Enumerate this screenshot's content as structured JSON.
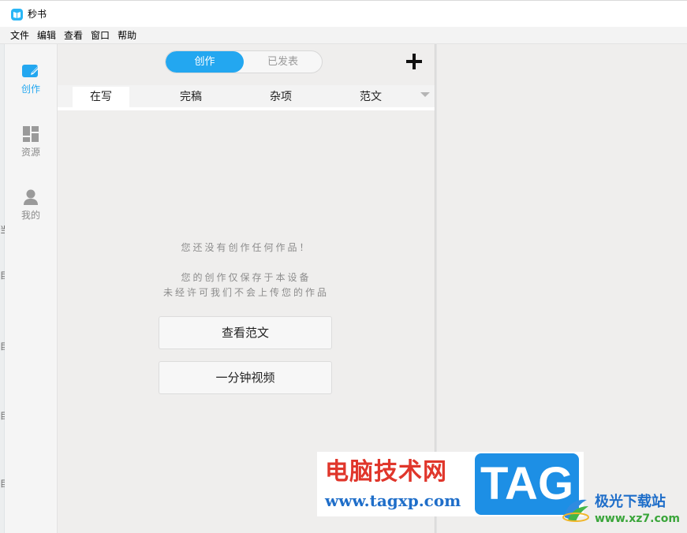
{
  "window": {
    "title": "秒书"
  },
  "menubar": {
    "items": [
      "文件",
      "编辑",
      "查看",
      "窗口",
      "帮助"
    ]
  },
  "leftnav": {
    "accent_color": "#23a7f0",
    "items": [
      {
        "label": "创作",
        "icon": "pencil-note-icon",
        "active": true
      },
      {
        "label": "资源",
        "icon": "grid-blocks-icon",
        "active": false
      },
      {
        "label": "我的",
        "icon": "user-icon",
        "active": false
      }
    ]
  },
  "main": {
    "segment": {
      "options": [
        "创作",
        "已发表"
      ],
      "selected": "创作"
    },
    "add_icon": "plus-icon",
    "tabs": {
      "items": [
        "在写",
        "完稿",
        "杂项",
        "范文"
      ],
      "selected": "在写"
    },
    "empty": {
      "line1": "您还没有创作任何作品！",
      "line2": "您的创作仅保存于本设备",
      "line3": "未经许可我们不会上传您的作品"
    },
    "buttons": {
      "view_samples": "查看范文",
      "one_minute_video": "一分钟视频"
    }
  },
  "watermark": {
    "cn_title": "电脑技术网",
    "url": "www.tagxp.com",
    "tag": "TAG",
    "site2_cn": "极光下载站",
    "site2_url": "www.xz7.com"
  }
}
